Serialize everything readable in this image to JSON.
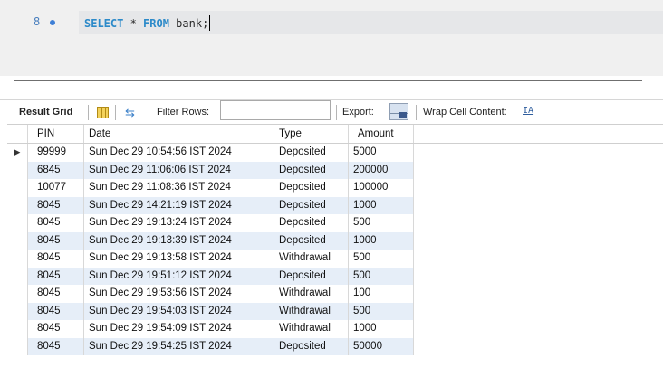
{
  "editor": {
    "line_number": "8",
    "code_keyword_select": "SELECT",
    "code_star": " * ",
    "code_keyword_from": "FROM",
    "code_table": " bank;"
  },
  "toolbar": {
    "result_grid_label": "Result Grid",
    "filter_rows_label": "Filter Rows:",
    "filter_value": "",
    "export_label": "Export:",
    "wrap_label": "Wrap Cell Content:",
    "wrap_icon_glyph": "IA"
  },
  "grid": {
    "columns": [
      "PIN",
      "Date",
      "Type",
      "Amount"
    ],
    "selected_marker": "▶",
    "rows": [
      {
        "pin": "99999",
        "date": "Sun Dec 29 10:54:56 IST 2024",
        "type": "Deposited",
        "amount": "5000"
      },
      {
        "pin": "6845",
        "date": "Sun Dec 29 11:06:06 IST 2024",
        "type": "Deposited",
        "amount": "200000"
      },
      {
        "pin": "10077",
        "date": "Sun Dec 29 11:08:36 IST 2024",
        "type": "Deposited",
        "amount": "100000"
      },
      {
        "pin": "8045",
        "date": "Sun Dec 29 14:21:19 IST 2024",
        "type": "Deposited",
        "amount": "1000"
      },
      {
        "pin": "8045",
        "date": "Sun Dec 29 19:13:24 IST 2024",
        "type": "Deposited",
        "amount": "500"
      },
      {
        "pin": "8045",
        "date": "Sun Dec 29 19:13:39 IST 2024",
        "type": "Deposited",
        "amount": "1000"
      },
      {
        "pin": "8045",
        "date": "Sun Dec 29 19:13:58 IST 2024",
        "type": "Withdrawal",
        "amount": "500"
      },
      {
        "pin": "8045",
        "date": "Sun Dec 29 19:51:12 IST 2024",
        "type": "Deposited",
        "amount": "500"
      },
      {
        "pin": "8045",
        "date": "Sun Dec 29 19:53:56 IST 2024",
        "type": "Withdrawal",
        "amount": "100"
      },
      {
        "pin": "8045",
        "date": "Sun Dec 29 19:54:03 IST 2024",
        "type": "Withdrawal",
        "amount": "500"
      },
      {
        "pin": "8045",
        "date": "Sun Dec 29 19:54:09 IST 2024",
        "type": "Withdrawal",
        "amount": "1000"
      },
      {
        "pin": "8045",
        "date": "Sun Dec 29 19:54:25 IST 2024",
        "type": "Deposited",
        "amount": "50000"
      }
    ]
  },
  "icons": {
    "grid_view": "result-grid-icon",
    "filter": "filter-arrows-icon",
    "export": "export-icon",
    "wrap": "wrap-cell-icon"
  }
}
